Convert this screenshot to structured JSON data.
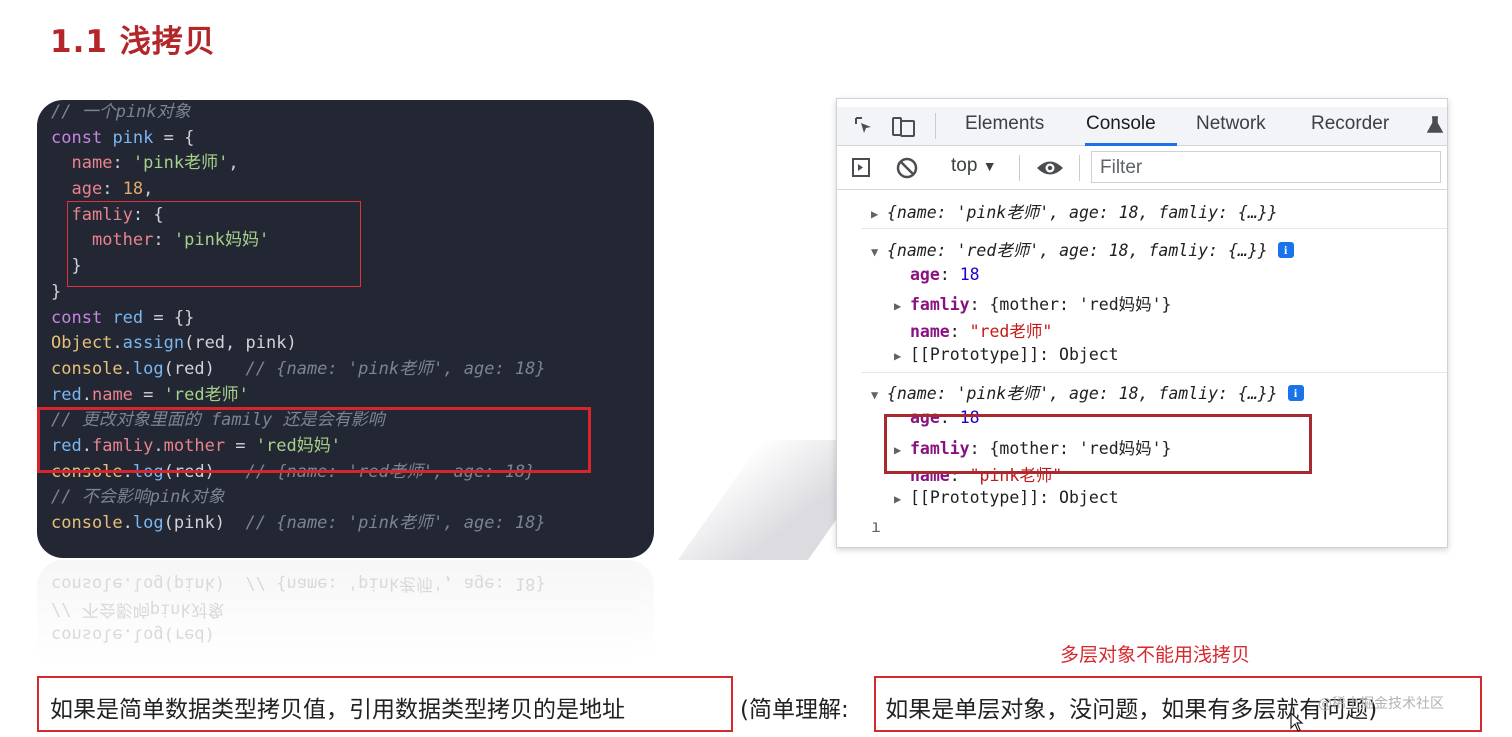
{
  "slide": {
    "title": "1.1 浅拷贝"
  },
  "code": {
    "line1": "// 一个pink对象",
    "kw_const": "const",
    "var_pink": "pink",
    "eq_brace": " = {",
    "prop_name": "name",
    "str_pink_teacher": "'pink老师'",
    "prop_age": "age",
    "num_18": "18",
    "prop_famliy": "famliy",
    "prop_mother": "mother",
    "str_pink_mom": "'pink妈妈'",
    "var_red": "red",
    "eq_empty": " = {}",
    "obj_Object": "Object",
    "fn_assign": "assign",
    "args_red_pink": "(red, pink)",
    "obj_console": "console",
    "fn_log": "log",
    "args_red": "(red)",
    "comment_red_log1": "// {name: 'pink老师', age: 18}",
    "str_red_teacher": "'red老师'",
    "comment_change": "// 更改对象里面的 family 还是会有影响",
    "str_red_mom": "'red妈妈'",
    "comment_red_log2": "// {name: 'red老师', age: 18}",
    "comment_no_affect": "// 不会影响pink对象",
    "args_pink": "(pink)",
    "comment_pink_log": "// {name: 'pink老师', age: 18}",
    "close_brace": "}",
    "close_brace_comma": "},"
  },
  "devtools": {
    "tabs": [
      "Elements",
      "Console",
      "Network",
      "Recorder"
    ],
    "context": "top",
    "filter_placeholder": "Filter",
    "rows": {
      "obj1_summary": "{name: 'pink老师', age: 18, famliy: {…}}",
      "obj2_summary": "{name: 'red老师', age: 18, famliy: {…}}",
      "obj3_summary": "{name: 'pink老师', age: 18, famliy: {…}}",
      "age_key": "age",
      "age_val": "18",
      "famliy_key": "famliy",
      "famliy_val_red": "{mother: 'red妈妈'}",
      "name_key": "name",
      "name_val_red": "\"red老师\"",
      "name_val_pink": "\"pink老师\"",
      "proto_key": "[[Prototype]]",
      "proto_val": "Object",
      "info_badge": "i"
    }
  },
  "bottom": {
    "warn_caption": "多层对象不能用浅拷贝",
    "left_text": "如果是简单数据类型拷贝值，引用数据类型拷贝的是地址",
    "middle_text": "(简单理解:",
    "right_text": " 如果是单层对象，没问题，如果有多层就有问题)",
    "watermark": "@稀土掘金技术社区"
  },
  "icons": {
    "inspect": "inspect-icon",
    "device": "device-toolbar-icon",
    "sidebar": "sidebar-toggle-icon",
    "clear": "clear-console-icon",
    "eye": "live-expression-icon",
    "flask": "flask-icon",
    "cursor": "cursor-icon"
  },
  "colors": {
    "title_red": "#b3272b",
    "highlight_red": "#d72a2e",
    "code_bg": "#232733",
    "devtools_active_tab": "#1a73e8"
  }
}
